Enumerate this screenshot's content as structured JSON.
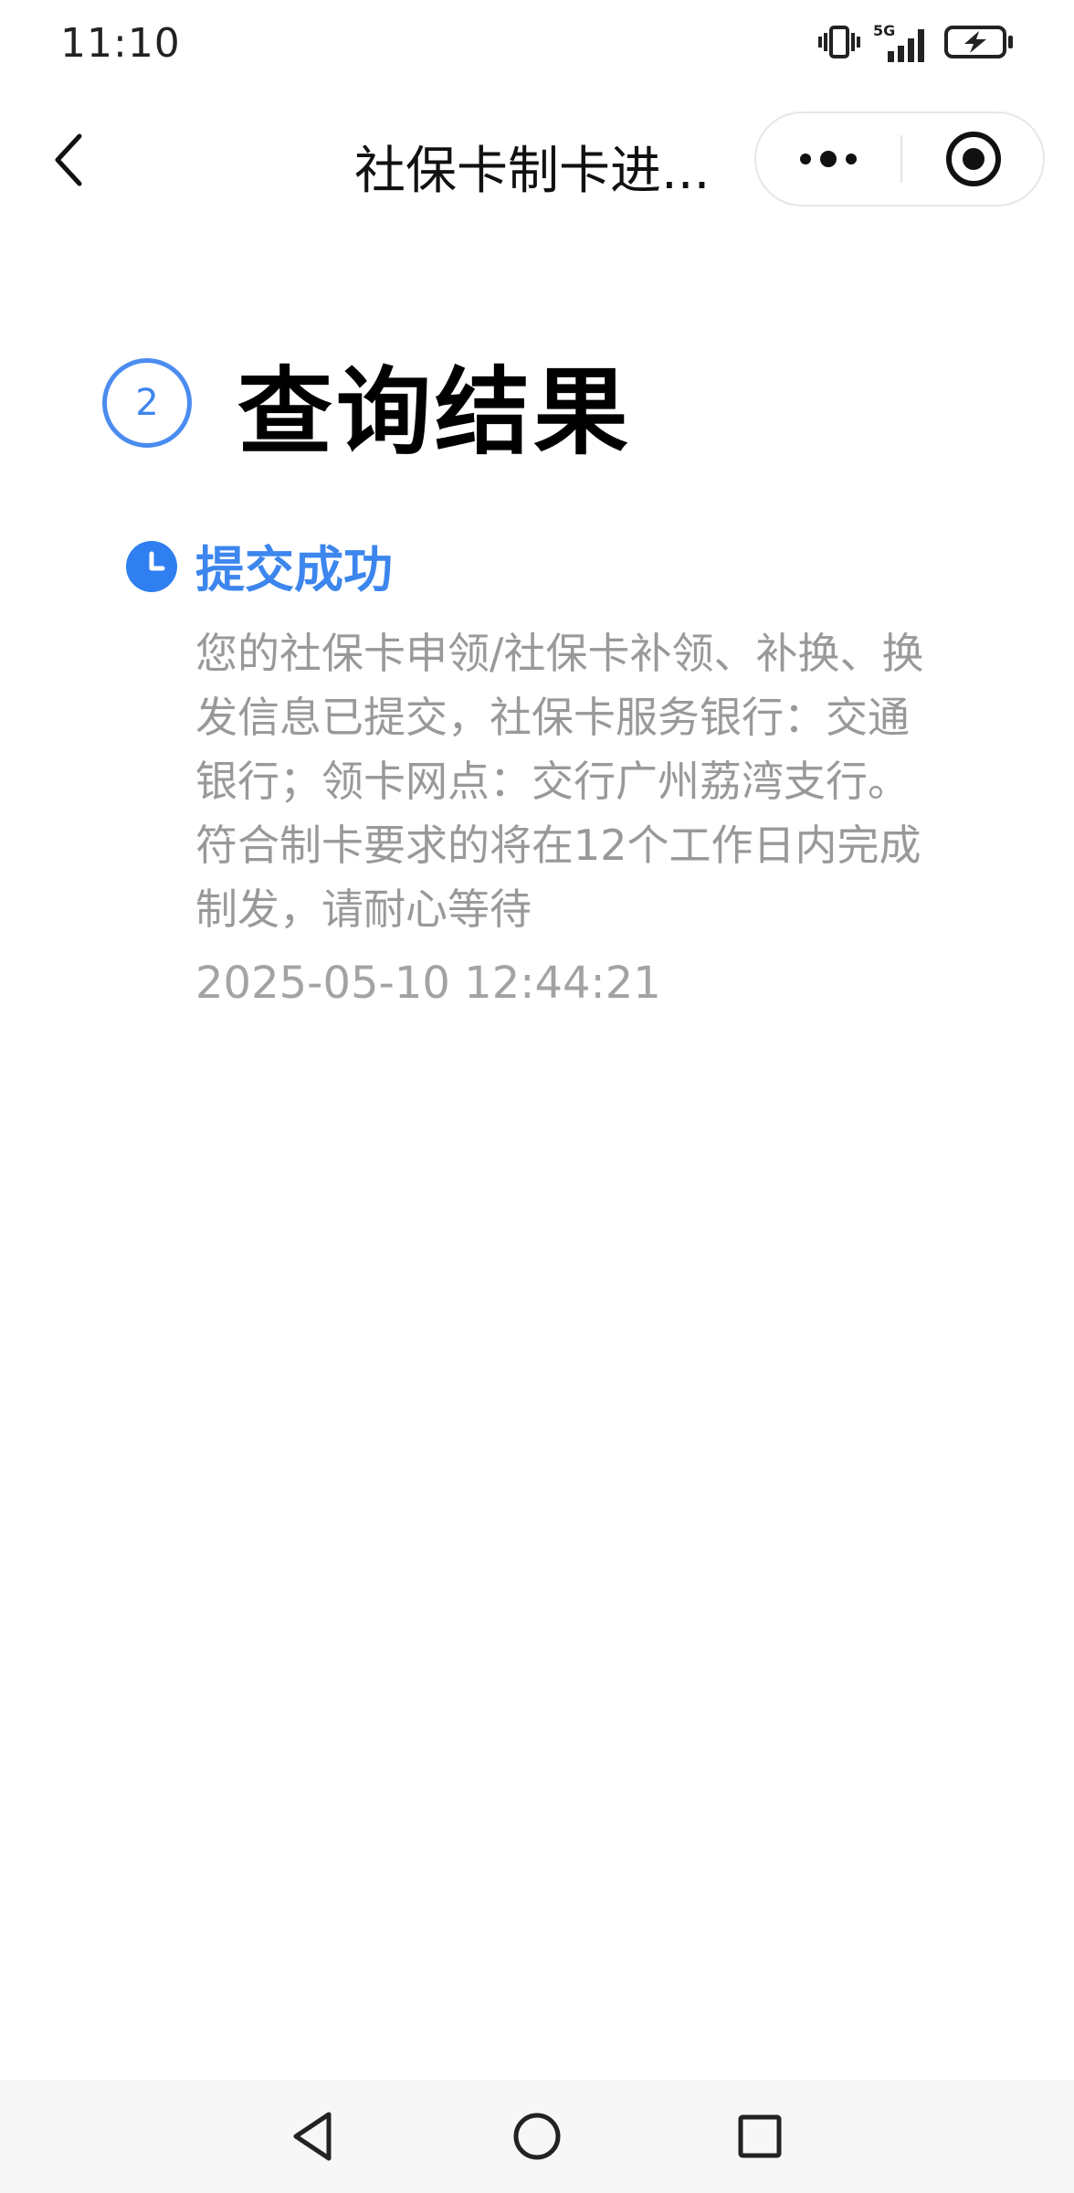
{
  "status_bar": {
    "time": "11:10",
    "network": "5G",
    "icons": [
      "vibrate-icon",
      "signal-icon",
      "battery-charging-icon"
    ]
  },
  "nav": {
    "title": "社保卡制卡进...",
    "icons": [
      "back-icon",
      "more-icon",
      "close-target-icon"
    ]
  },
  "step": {
    "number": "2",
    "title": "查询结果"
  },
  "timeline": {
    "status": "提交成功",
    "description": "您的社保卡申领/社保卡补领、补换、换发信息已提交，社保卡服务银行：交通银行；领卡网点：交行广州荔湾支行。符合制卡要求的将在12个工作日内完成制发，请耐心等待",
    "time": "2025-05-10 12:44:21",
    "icon": "clock-icon"
  },
  "bottom_nav": {
    "icons": [
      "back-triangle-icon",
      "home-circle-icon",
      "recents-square-icon"
    ]
  },
  "colors": {
    "accent": "#3c86ee",
    "text_secondary": "#999999"
  }
}
